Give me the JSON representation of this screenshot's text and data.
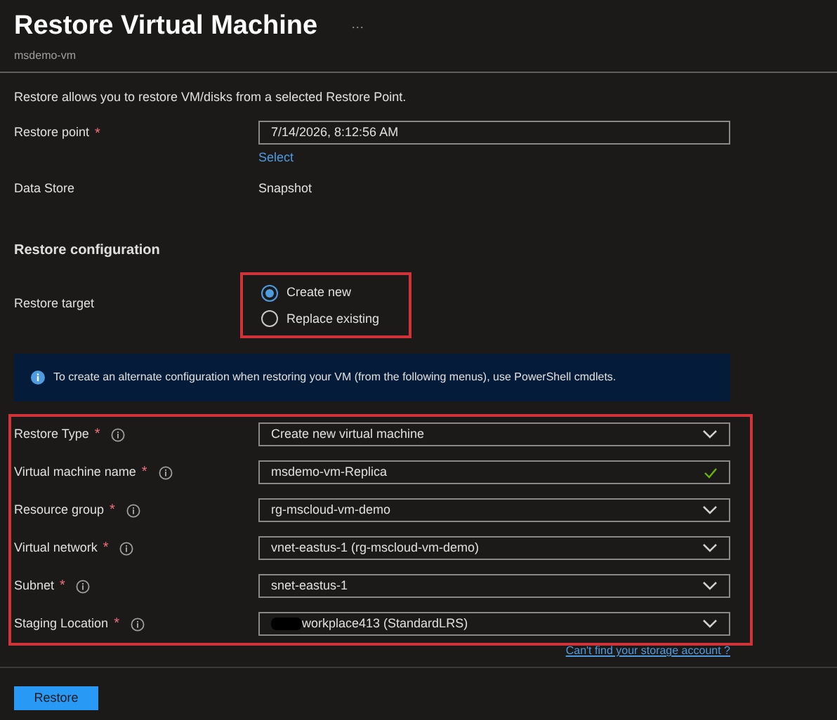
{
  "header": {
    "title": "Restore Virtual Machine",
    "more": "···",
    "subtitle": "msdemo-vm"
  },
  "description": "Restore allows you to restore VM/disks from a selected Restore Point.",
  "restore_point": {
    "label": "Restore point",
    "required_mark": "*",
    "value": "7/14/2026, 8:12:56 AM",
    "link": "Select"
  },
  "data_store": {
    "label": "Data Store",
    "value": "Snapshot"
  },
  "section_title": "Restore configuration",
  "restore_target": {
    "label": "Restore target",
    "options": [
      {
        "label": "Create new",
        "selected": true
      },
      {
        "label": "Replace existing",
        "selected": false
      }
    ]
  },
  "info_banner": "To create an alternate configuration when restoring your VM (from the following menus), use PowerShell cmdlets.",
  "fields": [
    {
      "label": "Restore Type",
      "required_mark": "*",
      "kind": "dropdown",
      "value": "Create new virtual machine"
    },
    {
      "label": "Virtual machine name",
      "required_mark": "*",
      "kind": "text",
      "value": "msdemo-vm-Replica",
      "valid": true
    },
    {
      "label": "Resource group",
      "required_mark": "*",
      "kind": "dropdown",
      "value": "rg-mscloud-vm-demo"
    },
    {
      "label": "Virtual network",
      "required_mark": "*",
      "kind": "dropdown",
      "value": "vnet-eastus-1 (rg-mscloud-vm-demo)"
    },
    {
      "label": "Subnet",
      "required_mark": "*",
      "kind": "dropdown",
      "value": "snet-eastus-1"
    },
    {
      "label": "Staging Location",
      "required_mark": "*",
      "kind": "dropdown",
      "value": "workplace413 (StandardLRS)",
      "redacted": true
    }
  ],
  "storage_link": "Can't find your storage account ?",
  "footer": {
    "button": "Restore"
  }
}
